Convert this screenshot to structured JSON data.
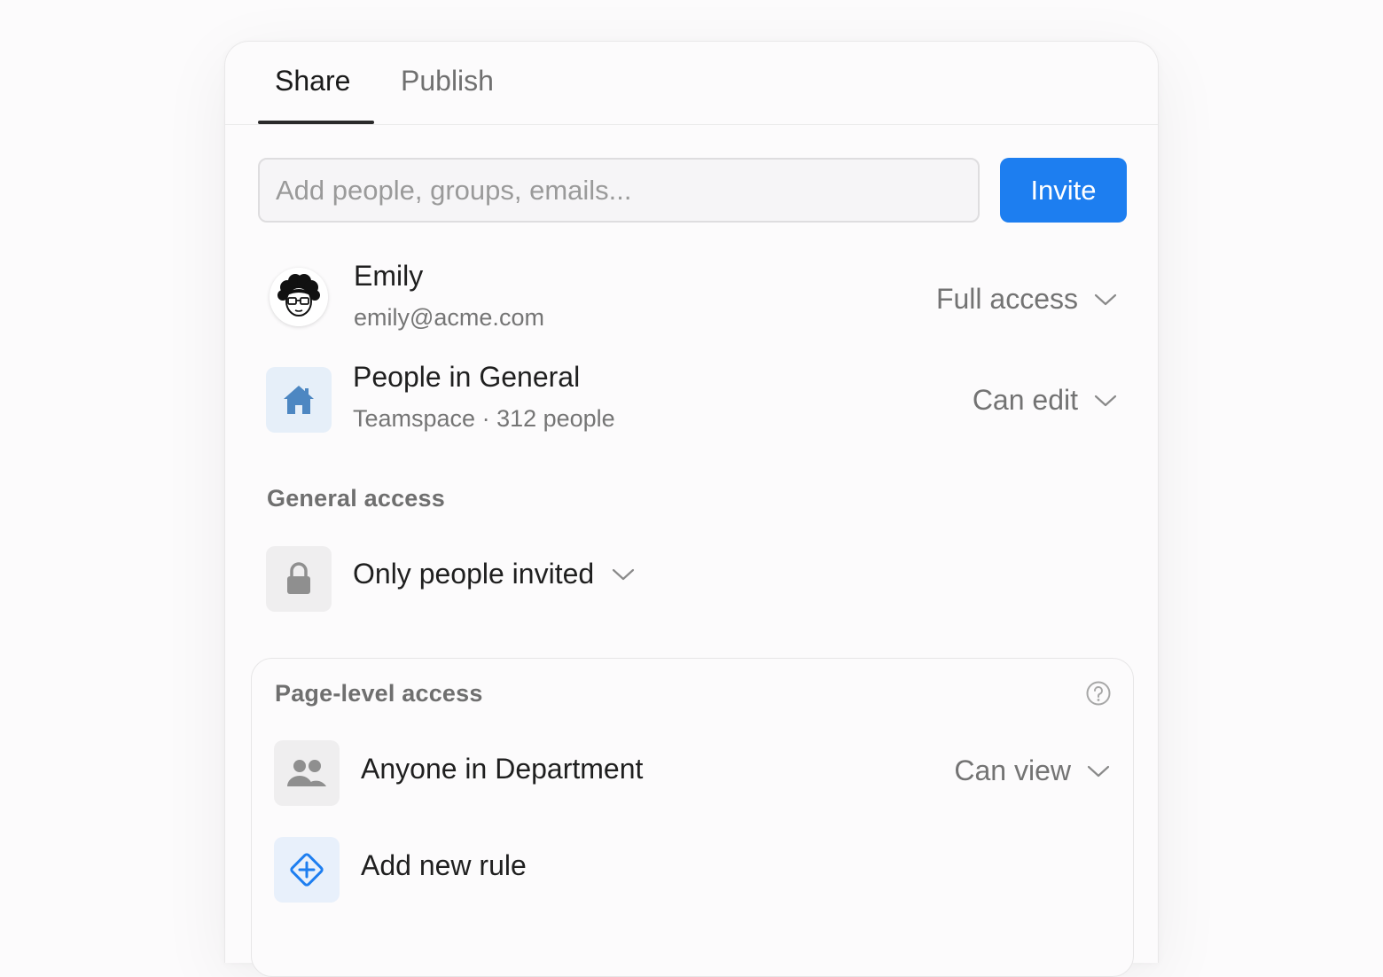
{
  "tabs": [
    {
      "label": "Share",
      "active": true
    },
    {
      "label": "Publish",
      "active": false
    }
  ],
  "invite": {
    "placeholder": "Add people, groups, emails...",
    "value": "",
    "button_label": "Invite"
  },
  "members": [
    {
      "name": "Emily",
      "subtitle": "emily@acme.com",
      "permission": "Full access",
      "icon": "avatar"
    },
    {
      "name": "People in General",
      "subtitle": "Teamspace · 312 people",
      "permission": "Can edit",
      "icon": "home-icon"
    }
  ],
  "general_access": {
    "heading": "General access",
    "value": "Only people invited",
    "icon": "lock-icon"
  },
  "page_level_access": {
    "heading": "Page-level access",
    "help_icon": "help-icon",
    "rules": [
      {
        "label": "Anyone in Department",
        "permission": "Can view",
        "icon": "group-icon"
      }
    ],
    "add_rule_label": "Add new rule",
    "add_rule_icon": "diamond-plus-icon"
  },
  "colors": {
    "accent": "#1d7ef0",
    "teamspace_icon": "#4d87c2",
    "teamspace_bg": "#e6eff9",
    "neutral_icon": "#8f8f8f",
    "neutral_bg": "#efeeef"
  }
}
